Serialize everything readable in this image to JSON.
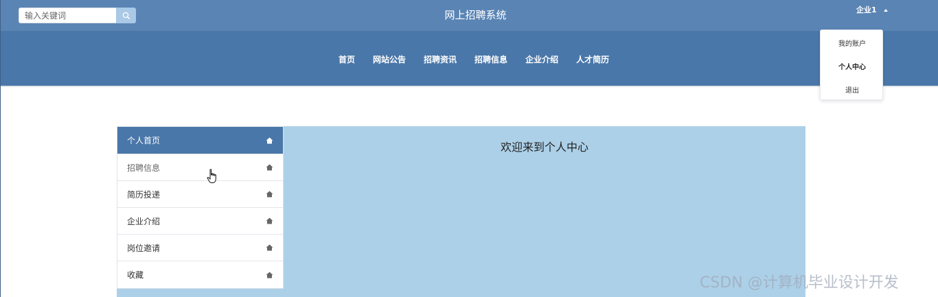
{
  "header": {
    "search": {
      "placeholder": "输入关键词",
      "value": ""
    },
    "site_title": "网上招聘系统",
    "user_name": "企业1"
  },
  "nav": {
    "items": [
      "首页",
      "网站公告",
      "招聘资讯",
      "招聘信息",
      "企业介绍",
      "人才简历"
    ]
  },
  "user_menu": {
    "items": [
      "我的账户",
      "个人中心",
      "退出"
    ],
    "active": "个人中心"
  },
  "sidebar": {
    "items": [
      "个人首页",
      "招聘信息",
      "简历投递",
      "企业介绍",
      "岗位邀请",
      "收藏"
    ],
    "active": "个人首页"
  },
  "main": {
    "welcome": "欢迎来到个人中心"
  },
  "watermark": "CSDN @计算机毕业设计开发",
  "colors": {
    "topbar": "#5a84b4",
    "navbar": "#4a77a9",
    "content_bg": "#acd0e8",
    "sidebar_active": "#4a77a9",
    "search_button": "#a9c9e6"
  },
  "icons": [
    "search-icon",
    "caret-up-icon",
    "home-icon",
    "hand-cursor-icon"
  ]
}
